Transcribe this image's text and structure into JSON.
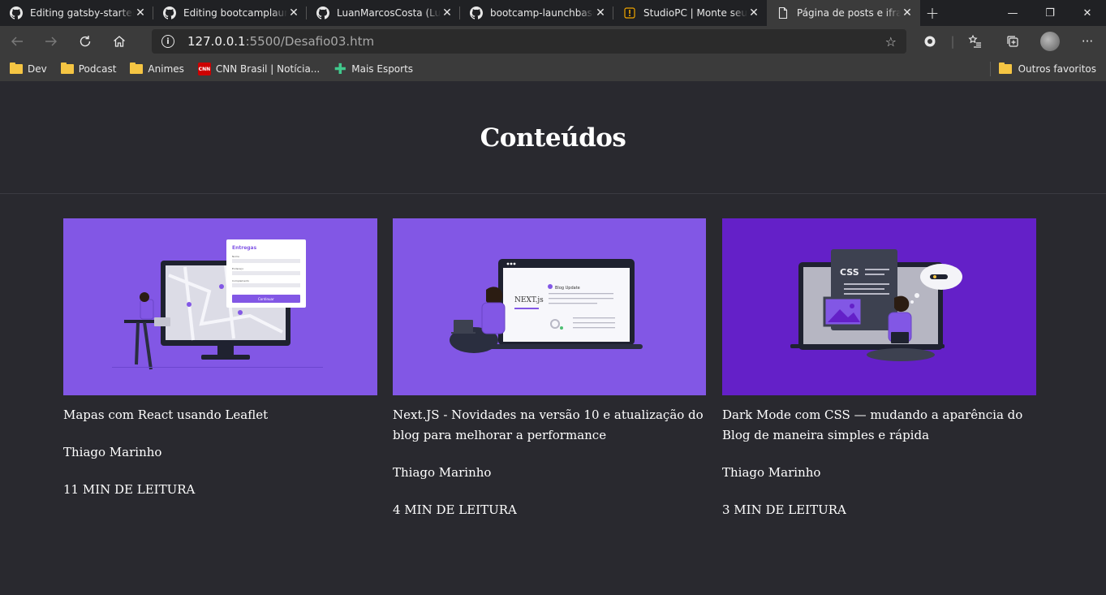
{
  "browser": {
    "tabs": [
      {
        "title": "Editing gatsby-starter-gatsby",
        "icon": "github-icon",
        "active": false
      },
      {
        "title": "Editing bootcamplaunchbase",
        "icon": "github-icon",
        "active": false
      },
      {
        "title": "LuanMarcosCosta (Luã",
        "icon": "github-icon",
        "active": false
      },
      {
        "title": "bootcamp-launchbase-",
        "icon": "github-icon",
        "active": false
      },
      {
        "title": "StudioPC | Monte seu P",
        "icon": "studiopc-icon",
        "active": false
      },
      {
        "title": "Página de posts e iframe",
        "icon": "page-icon",
        "active": true
      }
    ],
    "url_host": "127.0.0.1",
    "url_rest": ":5500/Desafio03.htm",
    "bookmarks": [
      {
        "label": "Dev",
        "icon": "folder-icon"
      },
      {
        "label": "Podcast",
        "icon": "folder-icon"
      },
      {
        "label": "Animes",
        "icon": "folder-icon"
      },
      {
        "label": "CNN Brasil | Notícia...",
        "icon": "cnn-icon"
      },
      {
        "label": "Mais Esports",
        "icon": "plus-icon"
      }
    ],
    "other_favorites": "Outros favoritos"
  },
  "page": {
    "title": "Conteúdos",
    "cards": [
      {
        "title": "Mapas com React usando Leaflet",
        "author": "Thiago Marinho",
        "read_time": "11 MIN DE LEITURA"
      },
      {
        "title": "Next.JS - Novidades na versão 10 e atualização do blog para melhorar a performance",
        "author": "Thiago Marinho",
        "read_time": "4 MIN DE LEITURA"
      },
      {
        "title": "Dark Mode com CSS — mudando a aparência do Blog de maneira simples e rápida",
        "author": "Thiago Marinho",
        "read_time": "3 MIN DE LEITURA"
      }
    ],
    "illustration_text": {
      "form_title": "Entregas",
      "form_fields": [
        "Nome",
        "Endereço",
        "Complemento"
      ],
      "form_button": "Continuar",
      "next_logo": "NEXT.js",
      "blog_update": "Blog Update",
      "css_label": "CSS"
    }
  },
  "colors": {
    "page_bg": "#29292f",
    "card_purple": "#8257e5",
    "card_dark_purple": "#6420c8"
  }
}
